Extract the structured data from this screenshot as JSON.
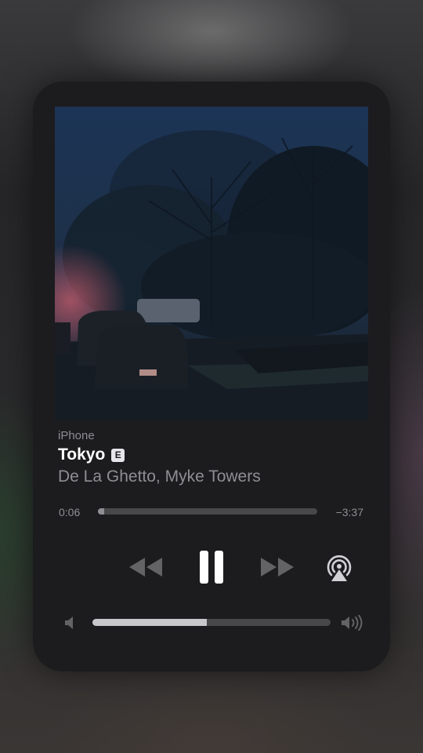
{
  "player": {
    "source": "iPhone",
    "title": "Tokyo",
    "explicit_badge": "E",
    "artist": "De La Ghetto, Myke Towers",
    "elapsed": "0:06",
    "remaining": "−3:37",
    "progress_fraction": 0.03,
    "volume_fraction": 0.48
  },
  "controls": {
    "rewind_icon": "rewind-icon",
    "pause_icon": "pause-icon",
    "forward_icon": "fast-forward-icon",
    "airplay_icon": "airplay-icon",
    "volume_low_icon": "speaker-low-icon",
    "volume_high_icon": "speaker-high-icon"
  },
  "colors": {
    "card": "#1c1c1e",
    "primary_text": "#ffffff",
    "secondary_text": "#8e8e93",
    "track": "#48484a",
    "volume_fill": "#c7c7cc"
  }
}
